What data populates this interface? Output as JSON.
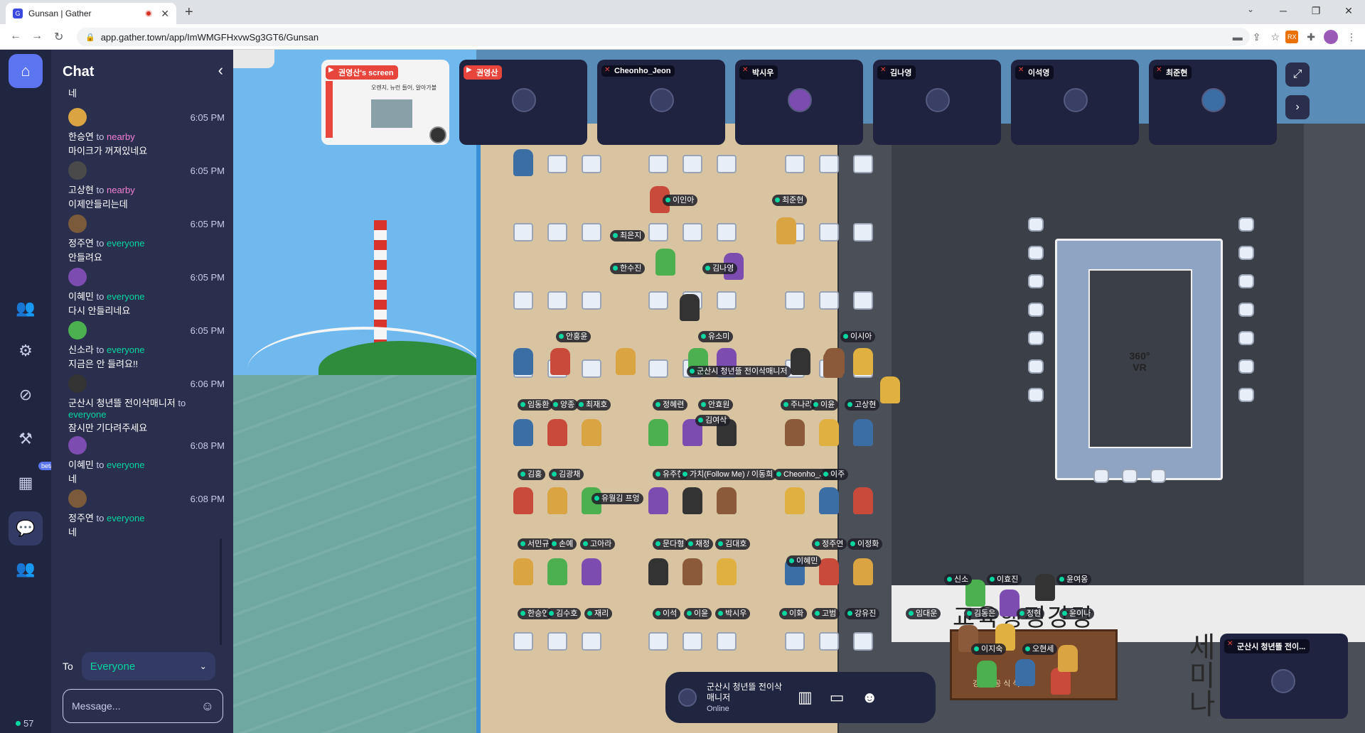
{
  "browser": {
    "tab_title": "Gunsan | Gather",
    "url": "app.gather.town/app/ImWMGFHxvwSg3GT6/Gunsan",
    "tab_close": "✕",
    "new_tab": "+"
  },
  "rail": {
    "beta_label": "beta",
    "online_count": "57"
  },
  "chat": {
    "title": "Chat",
    "partial_top": "네",
    "messages": [
      {
        "time": "6:05 PM",
        "sender": "한승연",
        "to_word": "to",
        "audience": "nearby",
        "text": "마이크가 꺼져있네요"
      },
      {
        "time": "6:05 PM",
        "sender": "고상현",
        "to_word": "to",
        "audience": "nearby",
        "text": "이제안들리는데"
      },
      {
        "time": "6:05 PM",
        "sender": "정주연",
        "to_word": "to",
        "audience": "everyone",
        "text": "안들려요"
      },
      {
        "time": "6:05 PM",
        "sender": "이혜민",
        "to_word": "to",
        "audience": "everyone",
        "text": "다시 안들리네요"
      },
      {
        "time": "6:05 PM",
        "sender": "신소라",
        "to_word": "to",
        "audience": "everyone",
        "text": "지금은 안 들려요!!"
      },
      {
        "time": "6:06 PM",
        "sender": "군산시 청년뜰 전이삭매니저",
        "to_word": "to",
        "audience": "everyone",
        "text": "잠시만 기다려주세요"
      },
      {
        "time": "6:08 PM",
        "sender": "이혜민",
        "to_word": "to",
        "audience": "everyone",
        "text": "네"
      },
      {
        "time": "6:08 PM",
        "sender": "정주연",
        "to_word": "to",
        "audience": "everyone",
        "text": "네"
      }
    ],
    "to_label": "To",
    "recipient": "Everyone",
    "input_placeholder": "Message..."
  },
  "video_tiles": {
    "screen_share_name": "권영산's screen",
    "screen_text": "오렌지, 뉴런 들어, 알아가볼",
    "tiles": [
      "권영산",
      "Cheonho_Jeon",
      "박시우",
      "김나영",
      "이석영",
      "최준현"
    ]
  },
  "map": {
    "vr_label": "360° VR",
    "room_label": "교육행정강당",
    "side_label": "세미나",
    "desk_label": "강당 · 공 식 석",
    "nametags": [
      "이인아",
      "최준현",
      "최은지",
      "한수진",
      "김나영",
      "안홍윤",
      "유소미",
      "이시아",
      "군산시 청년뜰 전이삭매니저",
      "임동환",
      "양종",
      "최재호",
      "정혜련",
      "안효원",
      "주나리",
      "이윤",
      "고상현",
      "김여삭",
      "김홍",
      "김광채",
      "유주현",
      "가치(Follow Me) / 이동희",
      "Cheonho_Jeon",
      "이주",
      "유월김 프엉",
      "서민규",
      "손예",
      "고아라",
      "문다형",
      "채정",
      "김대호",
      "정주연",
      "이정화",
      "이혜민",
      "한승연",
      "김수호",
      "재리",
      "이석",
      "이윤",
      "박시우",
      "이화",
      "고범",
      "강유진",
      "신소",
      "이효진",
      "윤여옹",
      "임대운",
      "김동은",
      "정현",
      "윤이나",
      "이지숙",
      "오현세"
    ]
  },
  "bottom_bar": {
    "name": "군산시 청년뜰 전이삭매니저",
    "status": "Online"
  },
  "mini_tile": {
    "name": "군산시 청년뜰 전이..."
  },
  "colors": {
    "accent": "#5b75f0",
    "everyone": "#06d6a0",
    "nearby": "#f77ed4",
    "rail_bg": "#202540",
    "chat_bg": "#2a2f4e"
  }
}
